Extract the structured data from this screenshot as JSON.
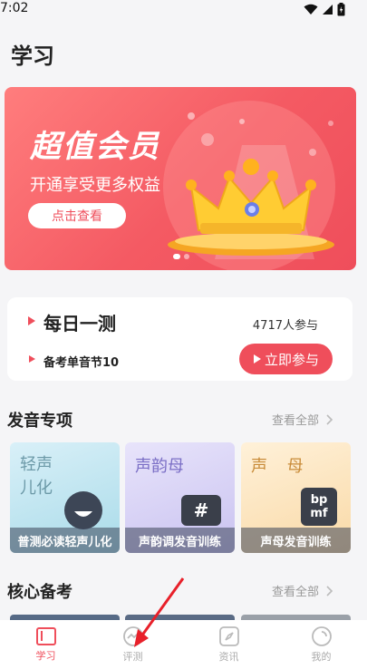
{
  "status": {
    "time": "7:02"
  },
  "page": {
    "title": "学习"
  },
  "banner": {
    "title": "超值会员",
    "subtitle": "开通享受更多权益",
    "cta": "点击查看"
  },
  "daily": {
    "title": "每日一测",
    "participants": "4717人参与",
    "subtitle": "备考单音节10",
    "join": "立即参与"
  },
  "pronunciation": {
    "title": "发音专项",
    "see_all": "查看全部",
    "cards": [
      {
        "title": "轻声儿化",
        "footer": "普测必读轻声儿化"
      },
      {
        "title": "声韵母",
        "footer": "声韵调发音训练",
        "badge": "#"
      },
      {
        "title": "声 母",
        "footer": "声母发音训练",
        "badge": "bp mf"
      }
    ]
  },
  "core": {
    "title": "核心备考",
    "see_all": "查看全部"
  },
  "tabbar": {
    "items": [
      {
        "label": "学习",
        "icon": "study-icon"
      },
      {
        "label": "评测",
        "icon": "assessment-icon"
      },
      {
        "label": "资讯",
        "icon": "compass-icon"
      },
      {
        "label": "我的",
        "icon": "profile-icon"
      }
    ]
  },
  "colors": {
    "accent": "#ef4e5b",
    "background": "#f5f5f7"
  }
}
